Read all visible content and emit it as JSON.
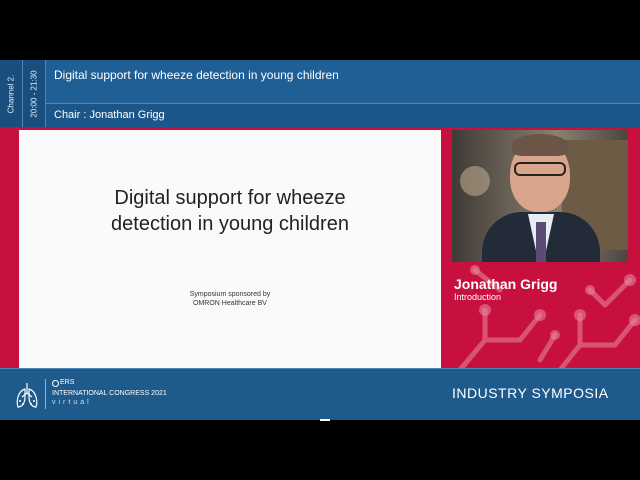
{
  "header": {
    "channel": "Channel 2.",
    "time": "20:00 - 21:30",
    "title": "Digital support for wheeze detection in young children",
    "chair": "Chair : Jonathan Grigg"
  },
  "slide": {
    "title_line1": "Digital support for wheeze",
    "title_line2": "detection in young children",
    "sponsor_line1": "Symposium sponsored by",
    "sponsor_line2": "OMRON Healthcare BV"
  },
  "speaker": {
    "name": "Jonathan Grigg",
    "role": "Introduction"
  },
  "footer": {
    "ers": "ERS",
    "congress": "INTERNATIONAL CONGRESS 2021",
    "virtual": "virtual",
    "section": "INDUSTRY SYMPOSIA"
  },
  "colors": {
    "header_blue": "#1f5a8c",
    "frame_red": "#c8103e",
    "slide_bg": "#fafafa"
  },
  "icons": [
    "lungs-logo-icon",
    "ers-circle-icon",
    "network-decoration-icon"
  ]
}
